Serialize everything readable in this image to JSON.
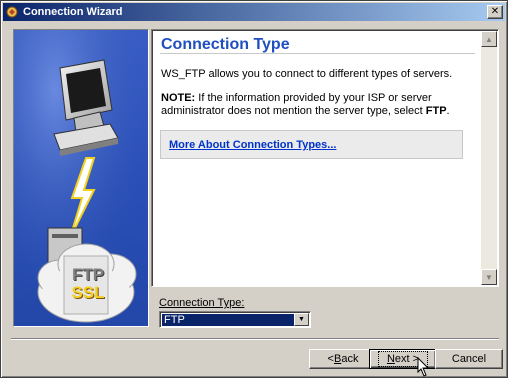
{
  "window": {
    "title": "Connection Wizard",
    "close_label": "✕"
  },
  "left_panel": {
    "badge_line1": "FTP",
    "badge_line2": "SSL"
  },
  "content": {
    "heading": "Connection Type",
    "description": "WS_FTP allows you to connect to different types of servers.",
    "note_label": "NOTE:",
    "note_text_1": " If the information provided by your ISP or server administrator does not mention the server type, select ",
    "note_emphasis": "FTP",
    "note_text_2": ".",
    "more_link": "More About Connection Types..."
  },
  "connection_type": {
    "label": "Connection Type:",
    "selected": "FTP"
  },
  "buttons": {
    "back_prefix": "< ",
    "back_key": "B",
    "back_rest": "ack",
    "next_key": "N",
    "next_rest": "ext >",
    "cancel": "Cancel"
  },
  "colors": {
    "heading": "#2050c0",
    "link": "#0033cc",
    "panel_blue": "#2a4fb8",
    "titlebar": "#0a246a"
  }
}
